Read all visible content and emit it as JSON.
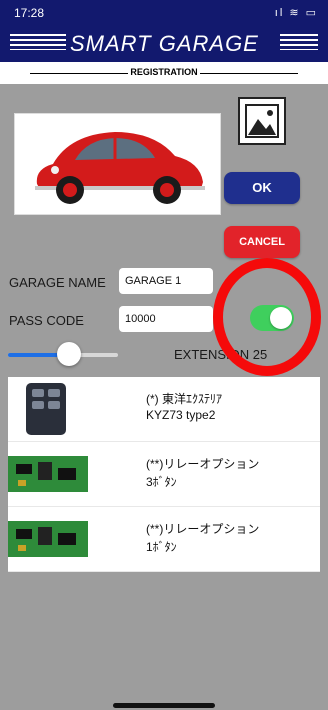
{
  "status": {
    "time": "17:28",
    "icons": "ıl ≋ ▭"
  },
  "header": {
    "title": "SMART GARAGE"
  },
  "section": {
    "title": "REGISTRATION"
  },
  "buttons": {
    "ok": "OK",
    "cancel": "CANCEL"
  },
  "form": {
    "garage_name_label": "GARAGE NAME",
    "garage_name_value": "GARAGE 1",
    "pass_code_label": "PASS CODE",
    "pass_code_value": "10000",
    "pass_code_toggle_on": true,
    "extension_label": "EXTENSION 25",
    "slider_level": 0.55
  },
  "colors": {
    "header": "#12196e",
    "ok": "#1f2f8e",
    "cancel": "#e2232a",
    "toggle": "#3fcf5d",
    "highlight": "#f50a0a"
  },
  "devices": [
    {
      "icon": "remote-control-icon",
      "line1": "(*) 東洋ｴｸｽﾃﾘｱ",
      "line2": "KYZ73 type2"
    },
    {
      "icon": "circuit-board-icon",
      "line1": "(**)リレーオプション",
      "line2": "3ﾎﾞﾀﾝ"
    },
    {
      "icon": "circuit-board-icon",
      "line1": "(**)リレーオプション",
      "line2": "1ﾎﾞﾀﾝ"
    }
  ]
}
